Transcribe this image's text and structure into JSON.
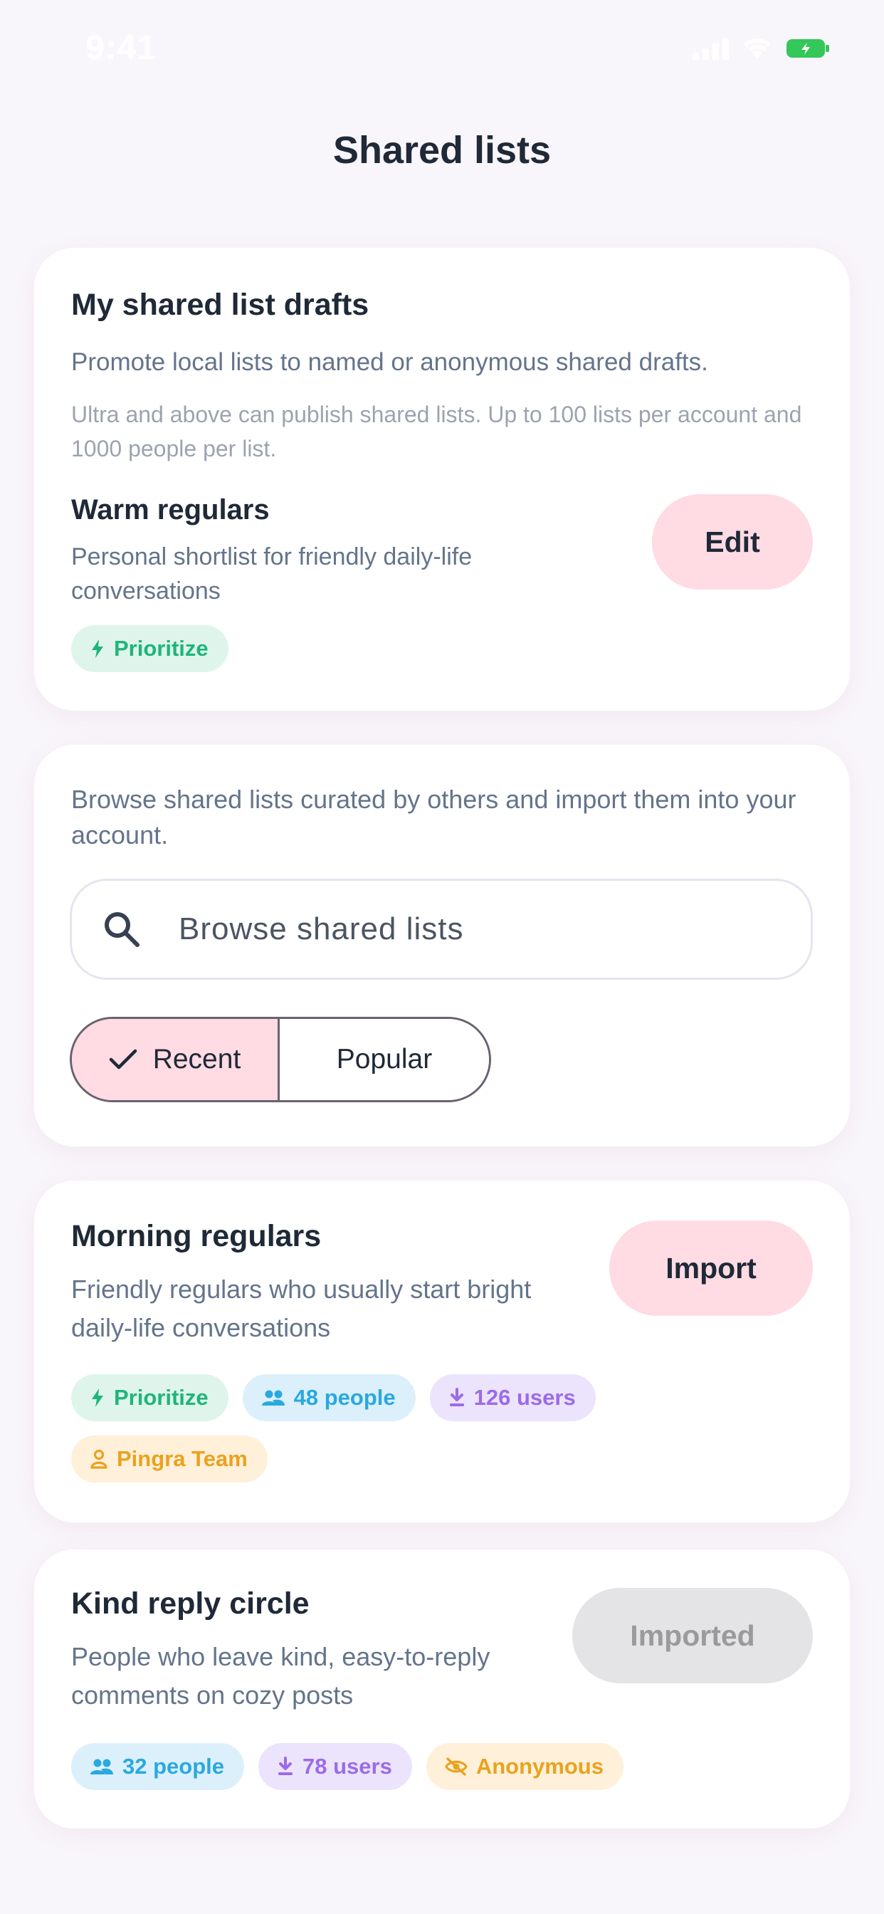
{
  "status_bar": {
    "time": "9:41"
  },
  "page": {
    "title": "Shared lists"
  },
  "drafts": {
    "title": "My shared list drafts",
    "description": "Promote local lists to named or anonymous shared drafts.",
    "note": "Ultra and above can publish shared lists. Up to 100 lists per account and 1000 people per list.",
    "item": {
      "name": "Warm regulars",
      "description": "Personal shortlist for friendly daily-life conversations",
      "chips": [
        "Prioritize"
      ],
      "button": "Edit"
    }
  },
  "browse": {
    "description": "Browse shared lists curated by others and import them into your account.",
    "search_placeholder": "Browse shared lists",
    "sort": {
      "selected": "Recent",
      "options": [
        "Recent",
        "Popular"
      ]
    }
  },
  "lists": [
    {
      "name": "Morning regulars",
      "description": "Friendly regulars who usually start bright daily-life conversations",
      "button": "Import",
      "chips": {
        "prioritize": "Prioritize",
        "people": "48 people",
        "users": "126 users",
        "author": "Pingra Team"
      }
    },
    {
      "name": "Kind reply circle",
      "description": "People who leave kind, easy-to-reply comments on cozy posts",
      "button": "Imported",
      "chips": {
        "people": "32 people",
        "users": "78 users",
        "visibility": "Anonymous"
      }
    }
  ],
  "colors": {
    "accent_pink": "#ffdbe3",
    "green": "#1fb57a",
    "blue": "#2aa8e0",
    "purple": "#9b6be8",
    "orange": "#eaa21e",
    "disabled": "#e4e3e5"
  },
  "icons": [
    "bolt-icon",
    "people-icon",
    "download-icon",
    "person-icon",
    "eye-off-icon",
    "search-icon",
    "check-icon",
    "wifi-icon",
    "battery-icon",
    "signal-icon"
  ]
}
